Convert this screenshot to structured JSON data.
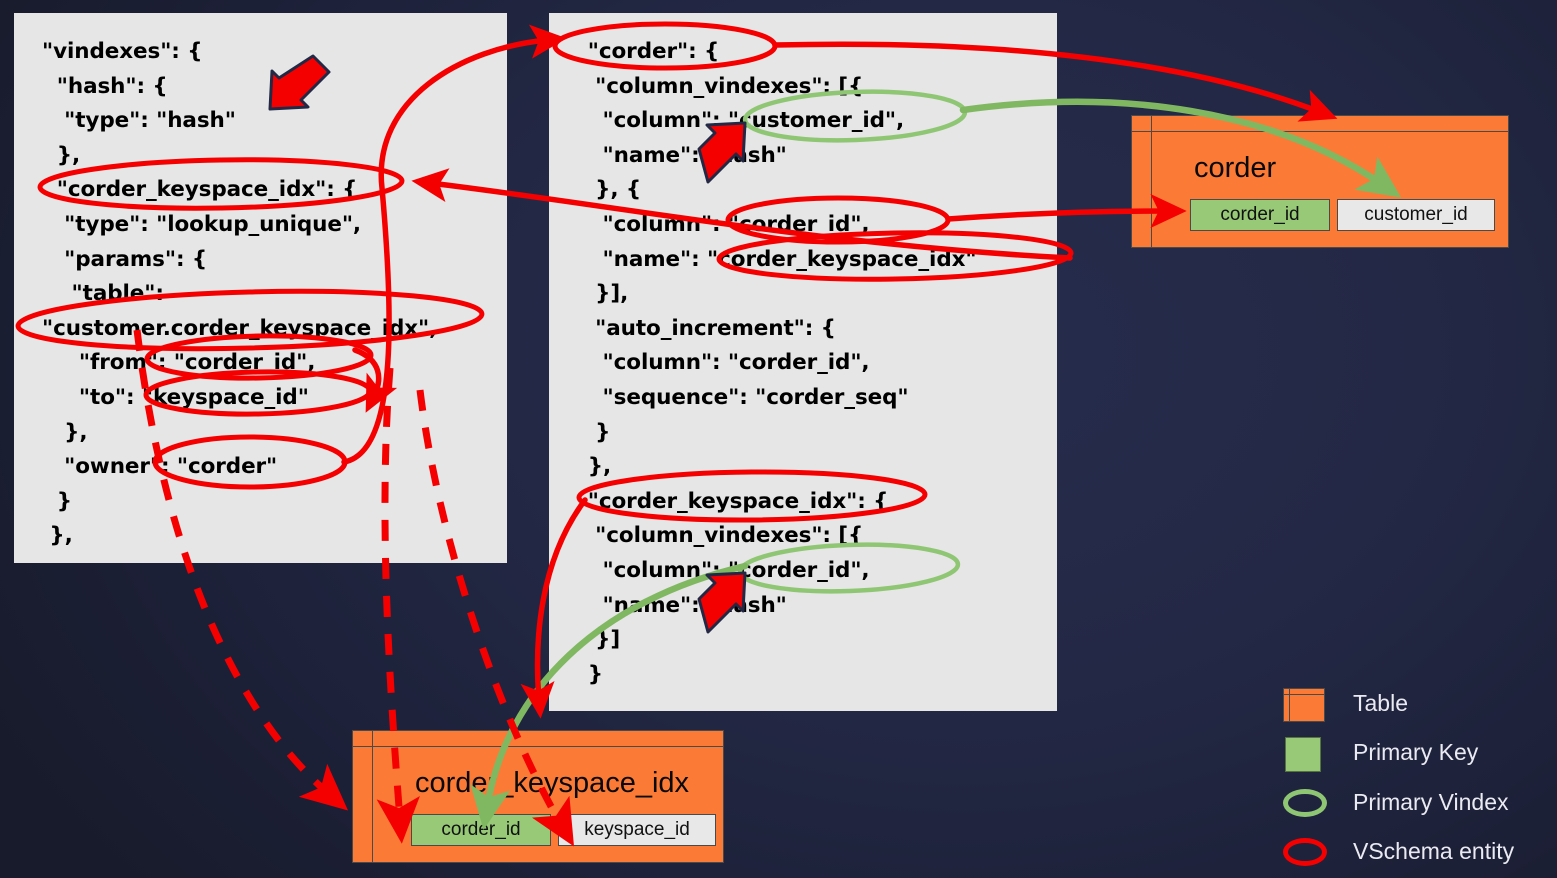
{
  "background": {
    "color_center": "#262c4c",
    "color_edge": "#181b2b"
  },
  "palette": {
    "table_orange": "#fb7b36",
    "primary_key_green": "#97c977",
    "primary_vindex_green": "#8fc673",
    "vschema_red": "#f50000",
    "panel_gray": "#e6e6e6",
    "legend_text": "#eaeaf2"
  },
  "panels": {
    "left": {
      "name": "customer-keyspace-vindexes-json",
      "code": "\"vindexes\": {\n  \"hash\": {\n   \"type\": \"hash\"\n  },\n  \"corder_keyspace_idx\": {\n   \"type\": \"lookup_unique\",\n   \"params\": {\n    \"table\":\n\"customer.corder_keyspace_idx\",\n     \"from\": \"corder_id\",\n     \"to\": \"keyspace_id\"\n   },\n   \"owner\": \"corder\"\n  }\n },"
    },
    "middle": {
      "name": "customer-keyspace-tables-json",
      "code": "  \"corder\": {\n   \"column_vindexes\": [{\n    \"column\": \"customer_id\",\n    \"name\": \"hash\"\n   }, {\n    \"column\": \"corder_id\",\n    \"name\": \"corder_keyspace_idx\"\n   }],\n   \"auto_increment\": {\n    \"column\": \"corder_id\",\n    \"sequence\": \"corder_seq\"\n   }\n  },\n  \"corder_keyspace_idx\": {\n   \"column_vindexes\": [{\n    \"column\": \"corder_id\",\n    \"name\": \"hash\"\n   }]\n  }"
    }
  },
  "tables": [
    {
      "id": "corder",
      "title": "corder",
      "columns": [
        {
          "name": "corder_id",
          "kind": "primary-key"
        },
        {
          "name": "customer_id",
          "kind": "column"
        }
      ]
    },
    {
      "id": "corder_keyspace_idx",
      "title": "corder_keyspace_idx",
      "columns": [
        {
          "name": "corder_id",
          "kind": "primary-key"
        },
        {
          "name": "keyspace_id",
          "kind": "column"
        }
      ]
    }
  ],
  "legend": {
    "items": [
      {
        "label": "Table",
        "swatch": "table-swatch"
      },
      {
        "label": "Primary Key",
        "swatch": "primary-key-swatch"
      },
      {
        "label": "Primary Vindex",
        "swatch": "primary-vindex-ellipse"
      },
      {
        "label": "VSchema entity",
        "swatch": "vschema-entity-ellipse"
      }
    ]
  },
  "annotations": {
    "red_ellipses": [
      "corder_keyspace_idx (vindex definition key, left panel)",
      "customer.corder_keyspace_idx (params.table value, left panel)",
      "corder_id (params.from value, left panel)",
      "keyspace_id (params.to value, left panel)",
      "corder (owner value, left panel)",
      "corder (table definition key, middle panel)",
      "corder_id (column_vindexes column, middle panel)",
      "corder_keyspace_idx (column_vindexes name, middle panel)",
      "corder_keyspace_idx (table definition key, middle panel)"
    ],
    "green_ellipses": [
      "customer_id (primary vindex column of corder)",
      "corder_id (primary vindex column of corder_keyspace_idx)"
    ],
    "red_arrow_markers": 4,
    "dashed_red_connectors": 3,
    "green_curved_connectors": 2
  }
}
